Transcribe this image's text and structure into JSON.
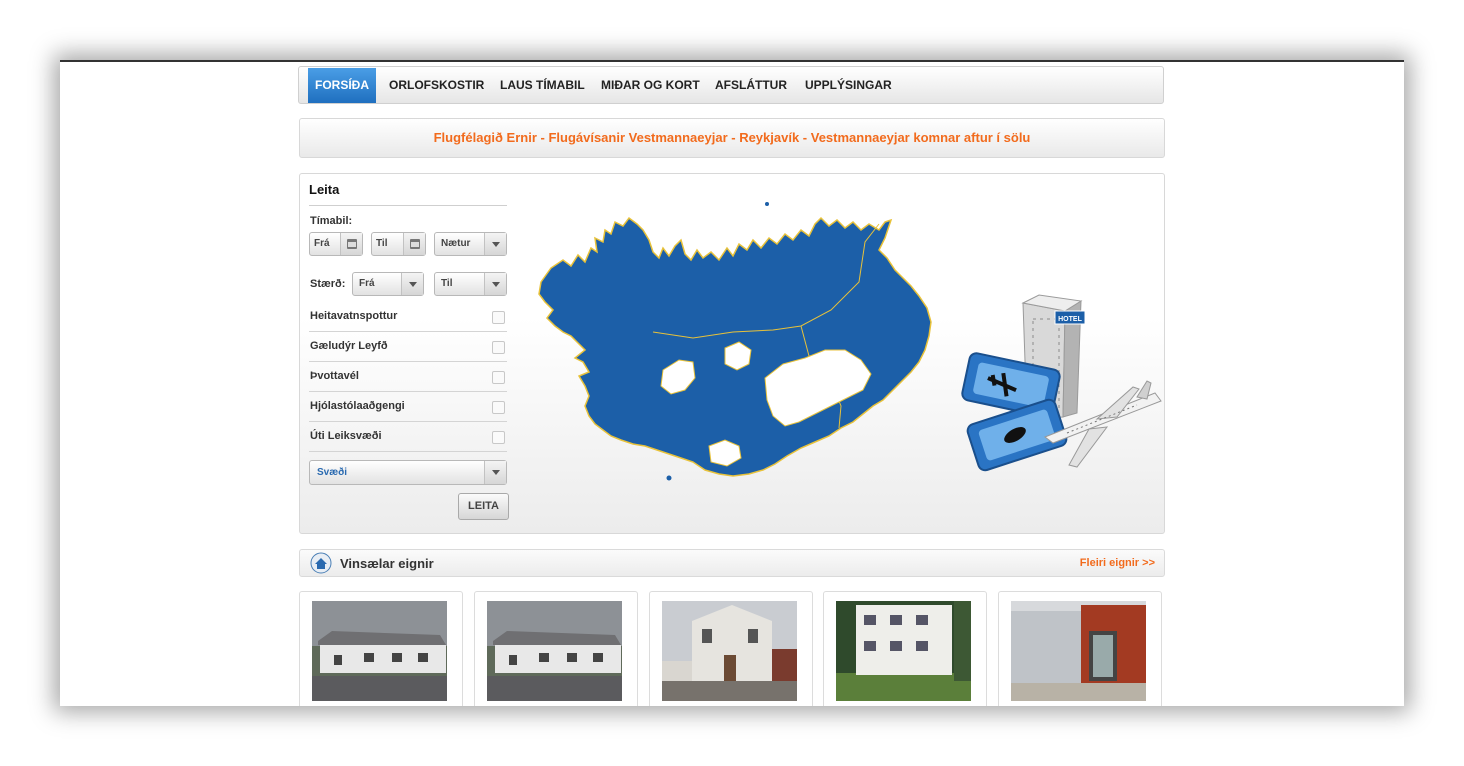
{
  "nav": {
    "items": [
      {
        "label": "FORSÍÐA",
        "active": true
      },
      {
        "label": "ORLOFSKOSTIR"
      },
      {
        "label": "LAUS TÍMABIL"
      },
      {
        "label": "MIÐAR OG KORT"
      },
      {
        "label": "AFSLÁTTUR"
      },
      {
        "label": "UPPLÝSINGAR"
      }
    ]
  },
  "banner": {
    "text": "Flugfélagið Ernir - Flugávísanir Vestmannaeyjar - Reykjavík - Vestmannaeyjar komnar aftur í sölu"
  },
  "search": {
    "title": "Leita",
    "period_label": "Tímabil:",
    "from_date": "Frá",
    "to_date": "Til",
    "nights": "Nætur",
    "size_label": "Stærð:",
    "size_from": "Frá",
    "size_to": "Til",
    "filters": [
      "Heitavatnspottur",
      "Gæludýr Leyfð",
      "Þvottavél",
      "Hjólastólaaðgengi",
      "Úti Leiksvæði"
    ],
    "region": "Svæði",
    "submit": "LEITA"
  },
  "illustration": {
    "hotel_sign": "HOTEL"
  },
  "popular": {
    "title": "Vinsælar eignir",
    "more": "Fleiri eignir >>"
  },
  "colors": {
    "accent_orange": "#f26b1d",
    "nav_active": "#2a7ccc",
    "map_blue": "#1c5fa8",
    "map_outline": "#e8c23a"
  },
  "icons": {
    "date_picker": "calendar-icon",
    "dropdown": "chevron-down-icon",
    "popular": "house-icon"
  }
}
